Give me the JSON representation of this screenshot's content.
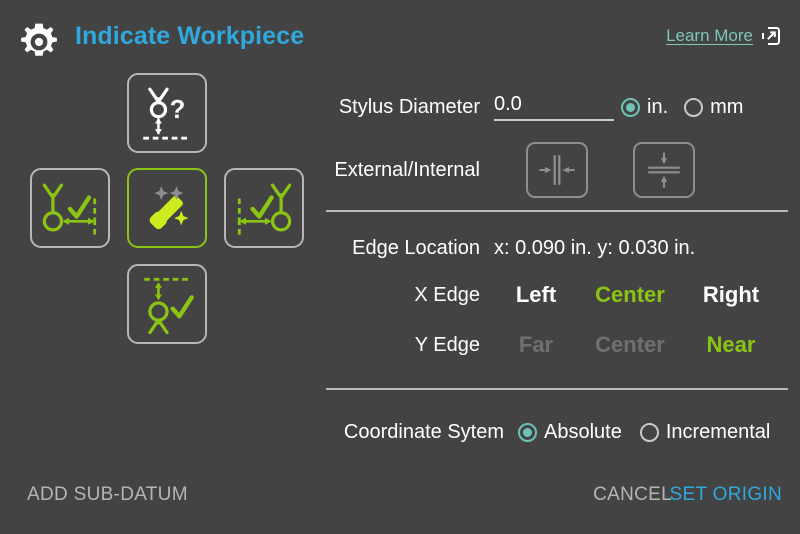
{
  "colors": {
    "background": "#434343",
    "accent_blue": "#2fa8dd",
    "accent_green": "#8cc414",
    "accent_teal": "#6fc3b2",
    "link_teal": "#7fc6b8",
    "text_white": "#ffffff",
    "text_muted": "#b5b5b5",
    "text_disabled": "#707070",
    "border_gray": "#b6b6b6"
  },
  "header": {
    "gear_icon": "gear-icon",
    "title": "Indicate Workpiece",
    "learn_more_label": "Learn More",
    "learn_more_icon": "external-link-icon"
  },
  "icon_cluster": {
    "tiles": [
      {
        "id": "unknown-edge",
        "icon": "probe-unknown-edge-icon",
        "position": "top",
        "selected": false,
        "color": "#ffffff"
      },
      {
        "id": "x-edge-left",
        "icon": "probe-x-edge-left-icon",
        "position": "left",
        "selected": false,
        "color": "#8cc414"
      },
      {
        "id": "auto-detect",
        "icon": "magic-wand-icon",
        "position": "center",
        "selected": true,
        "color": "#8cc414"
      },
      {
        "id": "x-edge-right",
        "icon": "probe-x-edge-right-icon",
        "position": "right",
        "selected": false,
        "color": "#8cc414"
      },
      {
        "id": "y-edge-near",
        "icon": "probe-y-edge-near-icon",
        "position": "bottom",
        "selected": false,
        "color": "#8cc414"
      }
    ]
  },
  "form": {
    "stylus": {
      "label": "Stylus Diameter",
      "value": "0.0",
      "placeholder": "0.0",
      "units": [
        {
          "label": "in.",
          "selected": true
        },
        {
          "label": "mm",
          "selected": false
        }
      ]
    },
    "external_internal": {
      "label": "External/Internal",
      "buttons": [
        {
          "id": "external",
          "icon": "external-measure-icon",
          "selected": false,
          "disabled": true
        },
        {
          "id": "internal",
          "icon": "internal-measure-icon",
          "selected": false,
          "disabled": true
        }
      ]
    },
    "edge_location": {
      "label": "Edge Location",
      "value": "x: 0.090 in. y: 0.030 in."
    },
    "x_edge": {
      "label": "X Edge",
      "options": [
        {
          "label": "Left",
          "state": "inactive"
        },
        {
          "label": "Center",
          "state": "active"
        },
        {
          "label": "Right",
          "state": "inactive"
        }
      ]
    },
    "y_edge": {
      "label": "Y Edge",
      "options": [
        {
          "label": "Far",
          "state": "disabled"
        },
        {
          "label": "Center",
          "state": "disabled"
        },
        {
          "label": "Near",
          "state": "active"
        }
      ]
    },
    "coordinate_system": {
      "label": "Coordinate Sytem",
      "options": [
        {
          "label": "Absolute",
          "selected": true
        },
        {
          "label": "Incremental",
          "selected": false
        }
      ]
    }
  },
  "footer": {
    "add_sub_datum_label": "ADD SUB-DATUM",
    "cancel_label": "CANCEL",
    "set_origin_label": "SET ORIGIN"
  }
}
